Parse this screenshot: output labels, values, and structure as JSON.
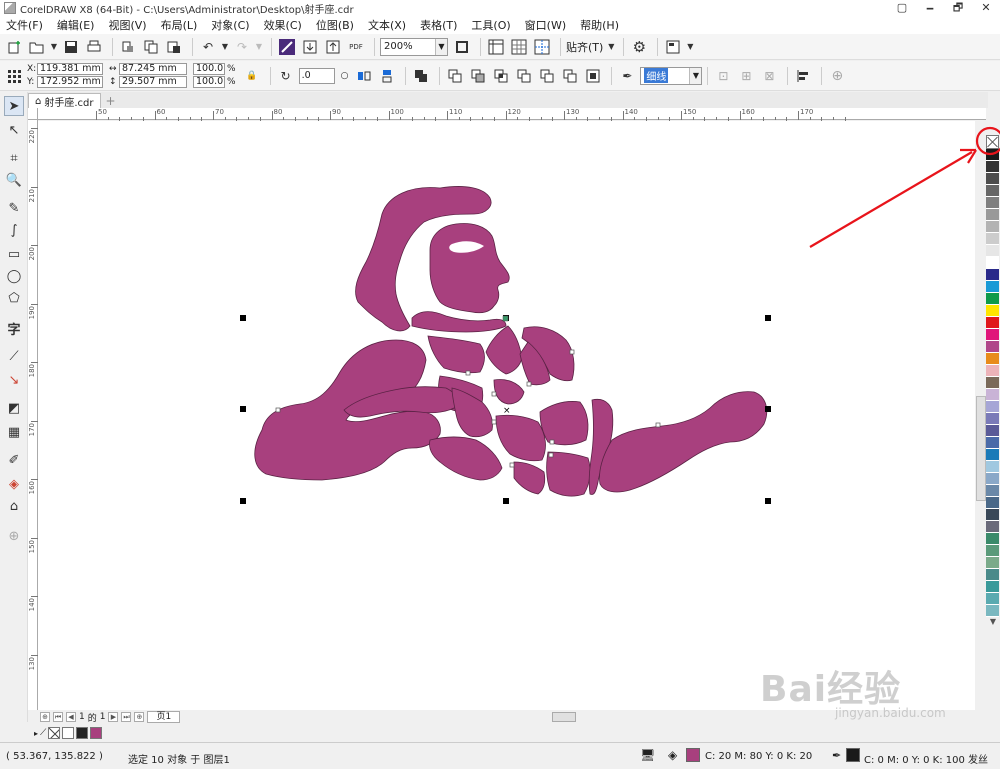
{
  "window": {
    "title": "CorelDRAW X8 (64-Bit) - C:\\Users\\Administrator\\Desktop\\射手座.cdr",
    "buttons": [
      "🗕",
      "🗗",
      "✕"
    ]
  },
  "menu": [
    "文件(F)",
    "编辑(E)",
    "视图(V)",
    "布局(L)",
    "对象(C)",
    "效果(C)",
    "位图(B)",
    "文本(X)",
    "表格(T)",
    "工具(O)",
    "窗口(W)",
    "帮助(H)"
  ],
  "toolbar": {
    "zoom": "200%",
    "snap_label": "贴齐(T)",
    "pdf_label": "PDF"
  },
  "props": {
    "x": "119.381 mm",
    "y": "172.952 mm",
    "width": "87.245 mm",
    "height": "29.507 mm",
    "scale_x": "100.0",
    "scale_y": "100.0",
    "percent": "%",
    "rotation": ".0",
    "outline": "细线"
  },
  "tab": {
    "name": "射手座.cdr"
  },
  "ruler": {
    "h_labels": [
      "50",
      "60",
      "70",
      "80",
      "90",
      "100",
      "110",
      "120",
      "130",
      "140",
      "150",
      "160",
      "170"
    ],
    "v_labels": [
      "220",
      "210",
      "200",
      "190",
      "180",
      "170",
      "160",
      "150",
      "140",
      "130"
    ]
  },
  "pagenav": {
    "current": "1",
    "of": "的",
    "total": "1",
    "page_tab": "页1"
  },
  "status": {
    "coords": "( 53.367, 135.822 )",
    "selection": "选定 10 对象 于 图层1",
    "fill": "C: 20 M: 80 Y: 0 K: 20",
    "outline": "C: 0 M: 0 Y: 0 K: 100  发丝"
  },
  "colors": {
    "shape_fill": "#a8407e",
    "annotation": "#e8141b"
  },
  "palette": [
    "#1a1a1a",
    "#333333",
    "#4d4d4d",
    "#666666",
    "#7f7f7f",
    "#999999",
    "#b3b3b3",
    "#cccccc",
    "#e6e6e6",
    "#ffffff",
    "#2a2a8a",
    "#1a9ad6",
    "#0f9a4a",
    "#ffe500",
    "#e0161b",
    "#e0157a",
    "#b0478a",
    "#e88b1a",
    "#ecb3b9",
    "#7a6a5a",
    "#c9b3d6",
    "#a6a6d6",
    "#7a7ab8",
    "#5a5a98",
    "#4a6aa8",
    "#1a7ab8",
    "#a0c8e0",
    "#8aa8c8",
    "#6a88a8",
    "#4a6888",
    "#3a4858",
    "#6a6a7a",
    "#3a8a6a",
    "#5a9a7a",
    "#7aaa8a",
    "#4a8a8a",
    "#3a9a9a",
    "#5aaab0",
    "#7ab8c0"
  ],
  "watermark": {
    "text": "Bai经验",
    "sub": "jingyan.baidu.com"
  }
}
